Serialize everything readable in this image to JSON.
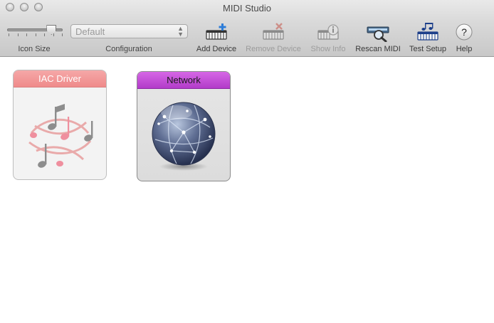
{
  "window": {
    "title": "MIDI Studio"
  },
  "toolbar": {
    "icon_size_label": "Icon Size",
    "icon_size_level": 0.8,
    "configuration_label": "Configuration",
    "configuration_value": "Default",
    "buttons": [
      {
        "label": "Add Device",
        "icon": "add-device-icon",
        "enabled": true
      },
      {
        "label": "Remove Device",
        "icon": "remove-device-icon",
        "enabled": false
      },
      {
        "label": "Show Info",
        "icon": "show-info-icon",
        "enabled": false
      },
      {
        "label": "Rescan MIDI",
        "icon": "rescan-midi-icon",
        "enabled": true
      },
      {
        "label": "Test Setup",
        "icon": "test-setup-icon",
        "enabled": true
      },
      {
        "label": "Help",
        "icon": "help-icon",
        "enabled": true
      }
    ]
  },
  "devices": [
    {
      "name": "IAC Driver",
      "icon": "music-notes-icon",
      "header_color": "#f09a9a"
    },
    {
      "name": "Network",
      "icon": "network-globe-icon",
      "header_color": "#c04fd6"
    }
  ]
}
